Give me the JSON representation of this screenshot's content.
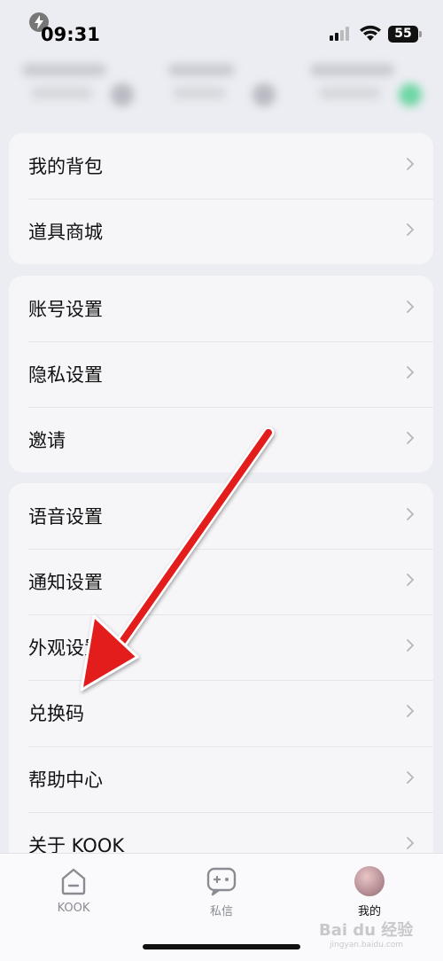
{
  "status_bar": {
    "time": "09:31",
    "battery": "55"
  },
  "groups": [
    {
      "items": [
        {
          "id": "backpack",
          "label": "我的背包"
        },
        {
          "id": "item-shop",
          "label": "道具商城"
        }
      ]
    },
    {
      "items": [
        {
          "id": "account-settings",
          "label": "账号设置"
        },
        {
          "id": "privacy-settings",
          "label": "隐私设置"
        },
        {
          "id": "invite",
          "label": "邀请"
        }
      ]
    },
    {
      "items": [
        {
          "id": "voice-settings",
          "label": "语音设置"
        },
        {
          "id": "notification-settings",
          "label": "通知设置"
        },
        {
          "id": "appearance-settings",
          "label": "外观设置"
        },
        {
          "id": "redeem-code",
          "label": "兑换码"
        },
        {
          "id": "help-center",
          "label": "帮助中心"
        },
        {
          "id": "about-kook",
          "label": "关于 KOOK"
        }
      ]
    }
  ],
  "tabbar": {
    "tabs": [
      {
        "id": "kook",
        "label": "KOOK",
        "icon": "home-face-icon",
        "active": false
      },
      {
        "id": "messages",
        "label": "私信",
        "icon": "chat-gamepad-icon",
        "active": false
      },
      {
        "id": "me",
        "label": "我的",
        "icon": "avatar",
        "active": true
      }
    ]
  },
  "watermark": {
    "main": "Bai du 经验",
    "sub": "jingyan.baidu.com"
  },
  "colors": {
    "annotation_arrow": "#e31b1b",
    "background": "#ecedf2"
  }
}
